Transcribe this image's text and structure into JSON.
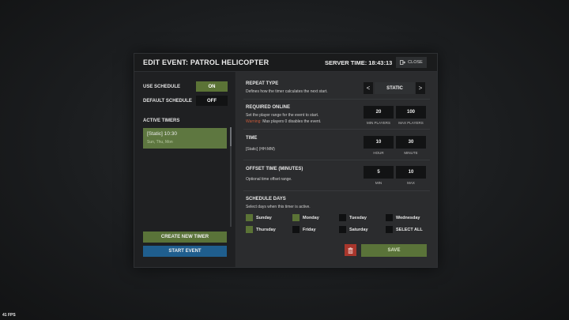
{
  "overlay": {
    "fps": "41 FPS"
  },
  "header": {
    "title": "EDIT EVENT: PATROL HELICOPTER",
    "server_time": "SERVER TIME: 18:43:13",
    "close_label": "CLOSE"
  },
  "left": {
    "use_schedule_label": "USE SCHEDULE",
    "use_schedule_value": "ON",
    "default_schedule_label": "DEFAULT SCHEDULE",
    "default_schedule_value": "OFF",
    "active_timers_label": "ACTIVE TIMERS",
    "timers": [
      {
        "title": "[Static] 10:30",
        "days": "Sun, Thu, Mon"
      }
    ],
    "create_label": "CREATE NEW TIMER",
    "start_label": "START EVENT"
  },
  "repeat": {
    "title": "REPEAT TYPE",
    "desc": "Defines how the timer calculates the next start.",
    "prev": "<",
    "value": "STATIC",
    "next": ">"
  },
  "online": {
    "title": "REQUIRED ONLINE",
    "desc": "Set the player range for the event to start.",
    "warning_word": "Warning:",
    "warning_text": "Max players 0 disables the event.",
    "min_value": "20",
    "min_label": "MIN PLAYERS",
    "max_value": "100",
    "max_label": "MAX PLAYERS"
  },
  "time": {
    "title": "TIME",
    "desc": "[Static] (HH:MM)",
    "hour_value": "10",
    "hour_label": "HOUR",
    "minute_value": "30",
    "minute_label": "MINUTE"
  },
  "offset": {
    "title": "OFFSET TIME (MINUTES)",
    "desc": "Optional time offset range.",
    "min_value": "5",
    "min_label": "MIN",
    "max_value": "10",
    "max_label": "MAX"
  },
  "days": {
    "title": "SCHEDULE DAYS",
    "desc": "Select days when this timer is active.",
    "items": [
      {
        "label": "Sunday",
        "checked": true
      },
      {
        "label": "Monday",
        "checked": true
      },
      {
        "label": "Tuesday",
        "checked": false
      },
      {
        "label": "Wednesday",
        "checked": false
      },
      {
        "label": "Thursday",
        "checked": true
      },
      {
        "label": "Friday",
        "checked": false
      },
      {
        "label": "Saturday",
        "checked": false
      },
      {
        "label": "SELECT ALL",
        "checked": false
      }
    ]
  },
  "footer": {
    "save_label": "SAVE"
  },
  "colors": {
    "accent_green": "#5b7336",
    "timer_green": "#5e7740",
    "start_blue": "#1f5e8e",
    "delete_red": "#a8362c",
    "warning": "#c75a3a"
  }
}
